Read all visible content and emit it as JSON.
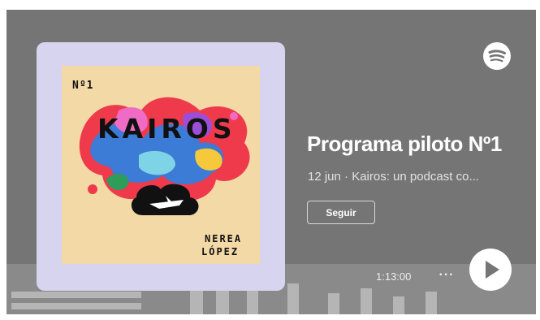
{
  "episode": {
    "title": "Programa piloto Nº1",
    "subtitle": "12 jun · Kairos: un podcast co...",
    "duration": "1:13:00"
  },
  "cover": {
    "number": "Nº1",
    "show_title": "KAIROS",
    "author_first": "NEREA",
    "author_last": "LÓPEZ"
  },
  "actions": {
    "follow_label": "Seguir",
    "more_label": "···"
  },
  "icons": {
    "brand": "spotify-logo-icon",
    "play": "play-icon",
    "more": "more-options-icon"
  },
  "colors": {
    "embed_background": "#757575",
    "cover_frame": "#d6d4ee",
    "cover_background": "#f3d9a6"
  }
}
